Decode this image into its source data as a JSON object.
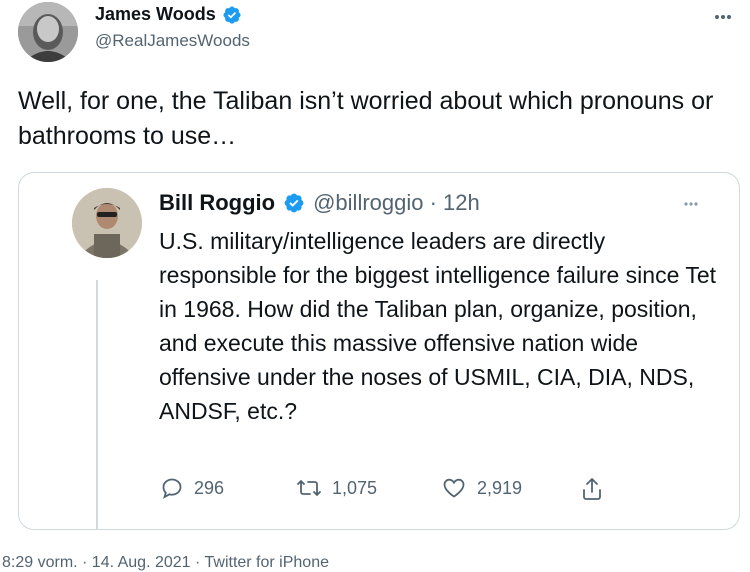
{
  "author": {
    "name": "James Woods",
    "handle": "@RealJamesWoods",
    "verified": true
  },
  "tweet": {
    "text": "Well, for one, the Taliban isn’t worried about which pronouns or bathrooms to use…"
  },
  "quoted": {
    "name": "Bill Roggio",
    "handle_time": "@billroggio · 12h",
    "verified": true,
    "text": "U.S. military/intelligence leaders are directly responsible for the biggest intelligence failure since Tet in 1968. How did the Taliban plan, organize, position, and execute this massive offensive nation wide offensive under the noses of USMIL, CIA, DIA, NDS, ANDSF, etc.?"
  },
  "actions": {
    "reply": "296",
    "retweet": "1,075",
    "like": "2,919"
  },
  "meta": {
    "timestamp": "8:29 vorm. · 14. Aug. 2021 · Twitter for iPhone"
  },
  "icons": {
    "verified": "verified-badge-icon",
    "more": "more-dots-icon",
    "reply": "reply-icon",
    "retweet": "retweet-icon",
    "like": "heart-icon",
    "share": "share-icon"
  },
  "colors": {
    "verified": "#1d9bf0",
    "text": "#0f1419",
    "secondary": "#536471",
    "border": "#cfd9de"
  }
}
